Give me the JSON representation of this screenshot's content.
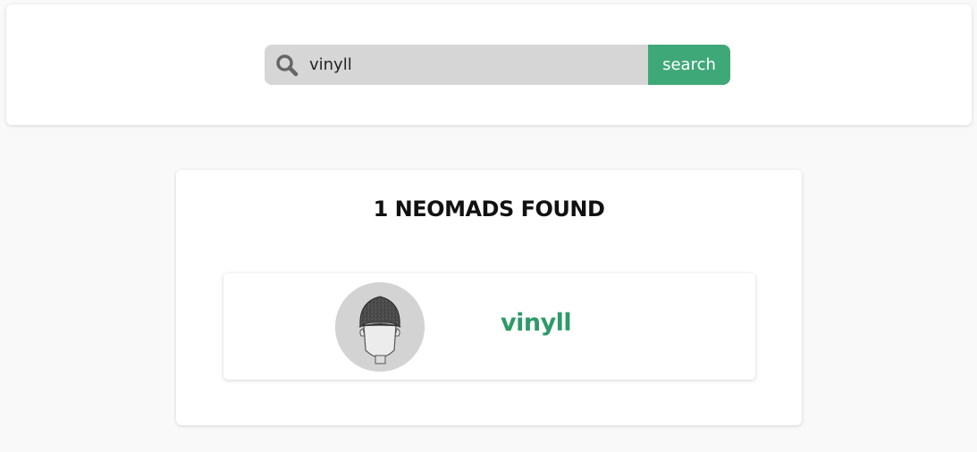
{
  "search": {
    "value": "vinyll",
    "button_label": "search",
    "icon": "search-icon"
  },
  "results": {
    "heading": "1 NEOMADS FOUND",
    "items": [
      {
        "username": "vinyll",
        "avatar": "avatar-image"
      }
    ]
  },
  "colors": {
    "accent": "#3fa878",
    "username": "#2e9a68",
    "search_field_bg": "#d6d6d6",
    "page_bg": "#f9f9f9"
  }
}
